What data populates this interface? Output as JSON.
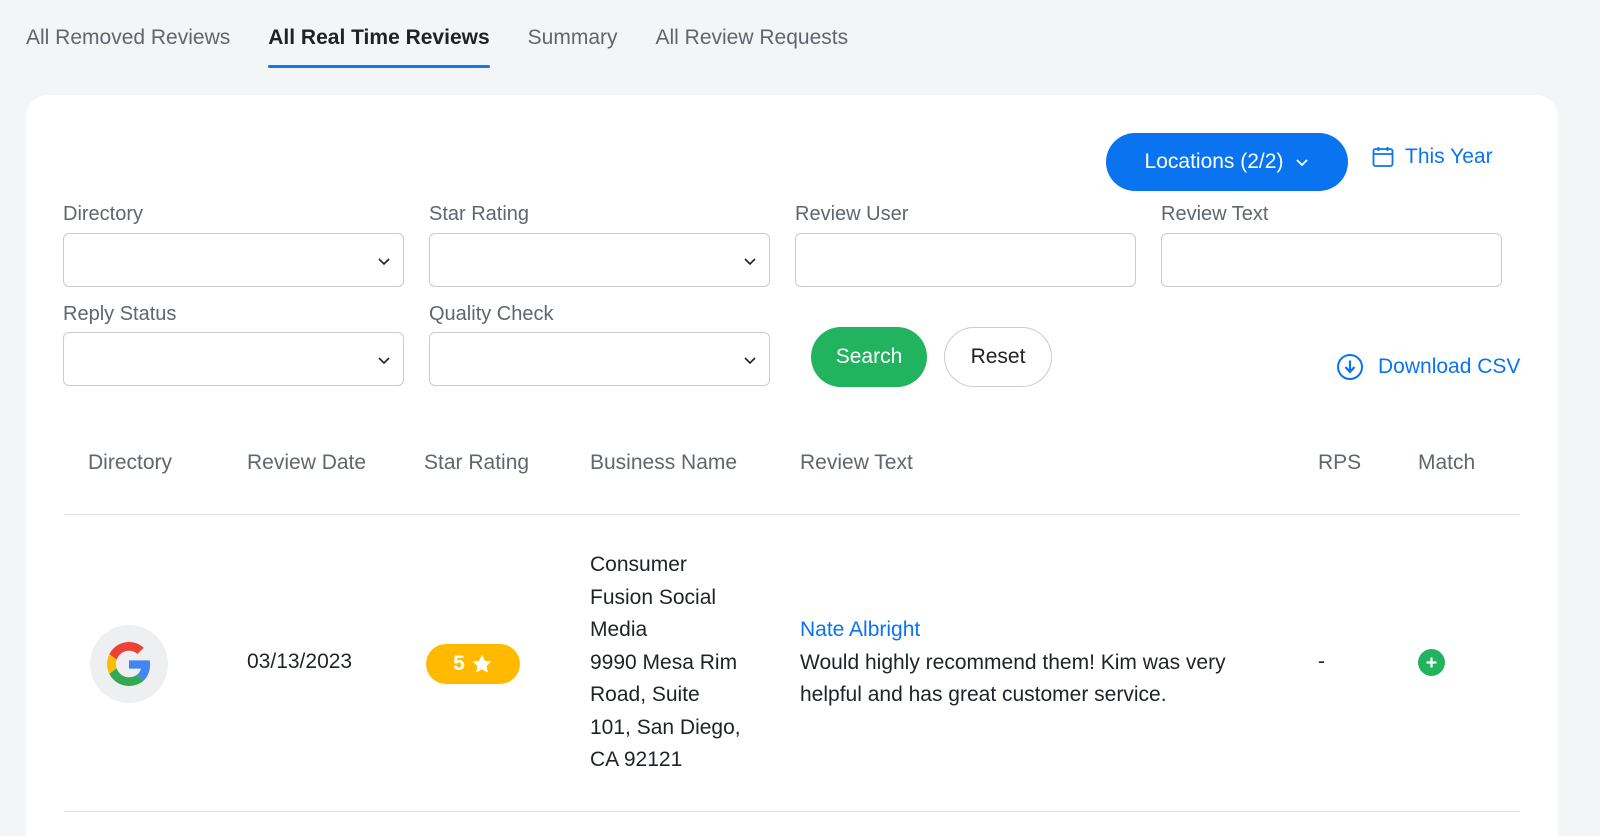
{
  "tabs": [
    {
      "label": "All Removed Reviews",
      "active": false
    },
    {
      "label": "All Real Time Reviews",
      "active": true
    },
    {
      "label": "Summary",
      "active": false
    },
    {
      "label": "All Review Requests",
      "active": false
    }
  ],
  "toolbar": {
    "locations_label": "Locations (2/2)",
    "date_range_label": "This Year"
  },
  "filters": {
    "directory": {
      "label": "Directory",
      "value": ""
    },
    "star_rating": {
      "label": "Star Rating",
      "value": ""
    },
    "review_user": {
      "label": "Review User",
      "value": ""
    },
    "review_text": {
      "label": "Review Text",
      "value": ""
    },
    "reply_status": {
      "label": "Reply Status",
      "value": ""
    },
    "quality_check": {
      "label": "Quality Check",
      "value": ""
    }
  },
  "actions": {
    "search_label": "Search",
    "reset_label": "Reset",
    "download_label": "Download CSV"
  },
  "table": {
    "columns": [
      "Directory",
      "Review Date",
      "Star Rating",
      "Business Name",
      "Review Text",
      "RPS",
      "Match"
    ],
    "rows": [
      {
        "directory_icon": "google-icon",
        "review_date": "03/13/2023",
        "star_rating": "5",
        "business_name_lines": [
          "Consumer",
          "Fusion Social",
          "Media",
          "9990 Mesa Rim",
          "Road, Suite",
          "101, San Diego,",
          "CA 92121"
        ],
        "reviewer": "Nate Albright",
        "review_text_lines": [
          "Would highly recommend them! Kim was very",
          "helpful and has great customer service."
        ],
        "rps": "-",
        "match_icon": "plus-circle-icon"
      }
    ]
  },
  "colors": {
    "primary": "#0a74f0",
    "success": "#22b35e",
    "star_badge": "#ffba00"
  }
}
